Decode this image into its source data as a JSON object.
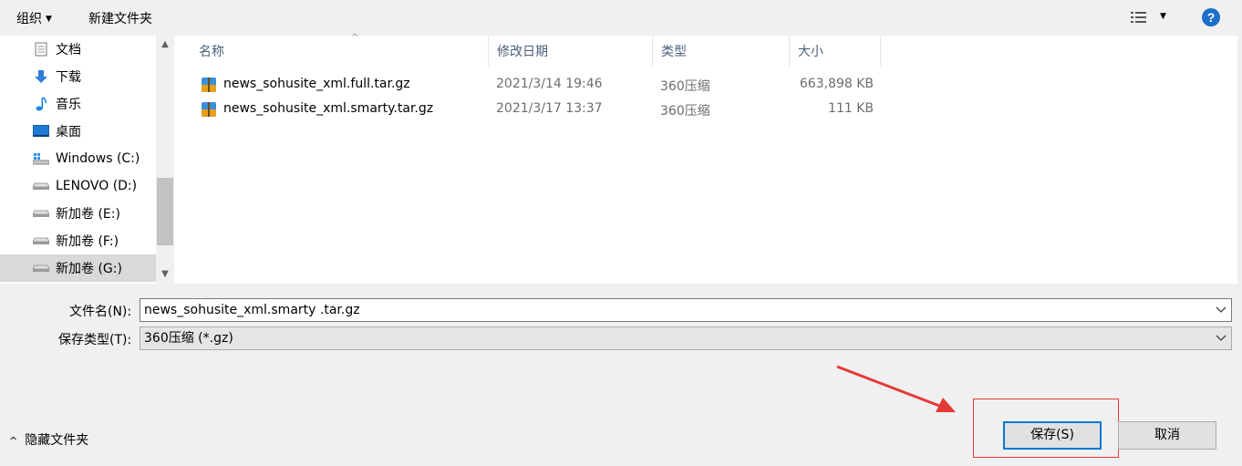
{
  "toolbar": {
    "organize_label": "组织",
    "new_folder_label": "新建文件夹",
    "help_label": "?"
  },
  "nav": {
    "items": [
      {
        "label": "文档",
        "icon": "document-icon"
      },
      {
        "label": "下载",
        "icon": "download-icon"
      },
      {
        "label": "音乐",
        "icon": "music-icon"
      },
      {
        "label": "桌面",
        "icon": "desktop-icon"
      },
      {
        "label": "Windows (C:)",
        "icon": "windows-drive-icon"
      },
      {
        "label": "LENOVO (D:)",
        "icon": "drive-icon"
      },
      {
        "label": "新加卷 (E:)",
        "icon": "drive-icon"
      },
      {
        "label": "新加卷 (F:)",
        "icon": "drive-icon"
      },
      {
        "label": "新加卷 (G:)",
        "icon": "drive-icon",
        "selected": true
      }
    ]
  },
  "columns": {
    "name": "名称",
    "date": "修改日期",
    "type": "类型",
    "size": "大小"
  },
  "files": [
    {
      "name": "news_sohusite_xml.full.tar.gz",
      "date": "2021/3/14 19:46",
      "type": "360压缩",
      "size": "663,898 KB"
    },
    {
      "name": "news_sohusite_xml.smarty.tar.gz",
      "date": "2021/3/17 13:37",
      "type": "360压缩",
      "size": "111 KB"
    }
  ],
  "form": {
    "filename_label": "文件名(N):",
    "filename_value": "news_sohusite_xml.smarty .tar.gz",
    "filetype_label": "保存类型(T):",
    "filetype_value": "360压缩 (*.gz)"
  },
  "footer": {
    "hide_folders_label": "隐藏文件夹",
    "save_label": "保存(S)",
    "cancel_label": "取消"
  },
  "colors": {
    "annotation": "#e53935",
    "accent": "#0078d7"
  }
}
